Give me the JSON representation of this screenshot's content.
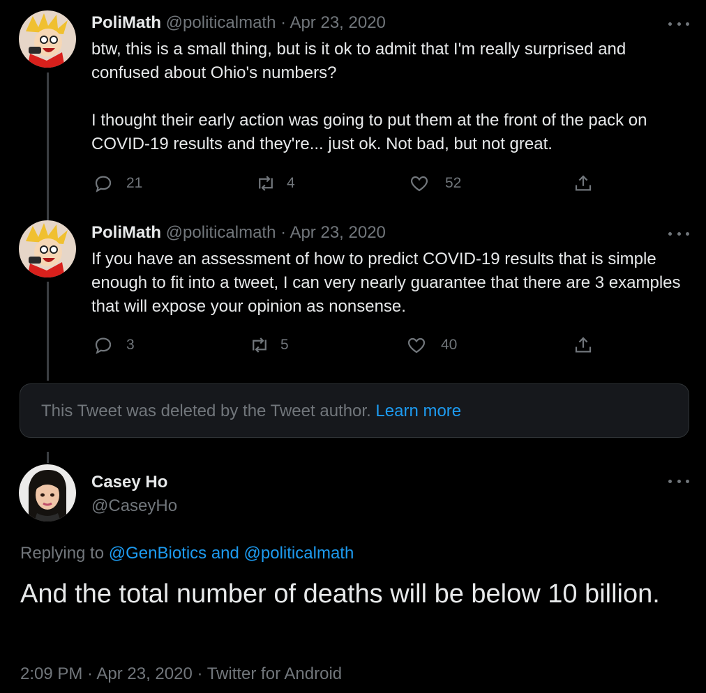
{
  "tweets": [
    {
      "name": "PoliMath",
      "handle": "@politicalmath",
      "separator": "·",
      "date": "Apr 23, 2020",
      "text": "btw, this is a small thing, but is it ok to admit that I'm really surprised and confused about Ohio's numbers?\n\nI thought their early action was going to put them at the front of the pack on COVID-19 results and they're... just ok. Not bad, but not great.",
      "replies": "21",
      "retweets": "4",
      "likes": "52"
    },
    {
      "name": "PoliMath",
      "handle": "@politicalmath",
      "separator": "·",
      "date": "Apr 23, 2020",
      "text": "If you have an assessment of how to predict COVID-19 results that is simple enough to fit into a tweet, I can very nearly guarantee that there are 3 examples that will expose your opinion as nonsense.",
      "replies": "3",
      "retweets": "5",
      "likes": "40"
    }
  ],
  "deleted": {
    "text": "This Tweet was deleted by the Tweet author.",
    "link": "Learn more"
  },
  "main": {
    "name": "Casey Ho",
    "handle": "@CaseyHo",
    "replying_prefix": "Replying to",
    "replying_to": "@GenBiotics and @politicalmath",
    "text": "And the total number of deaths will be below 10 billion.",
    "footer": "2:09 PM · Apr 23, 2020 · Twitter for Android"
  },
  "colors": {
    "background": "#000000",
    "link": "#1d9bf0",
    "muted": "#71767b",
    "text": "#e7e9ea"
  },
  "icons": [
    "reply-icon",
    "retweet-icon",
    "like-icon",
    "share-icon",
    "more-icon"
  ]
}
